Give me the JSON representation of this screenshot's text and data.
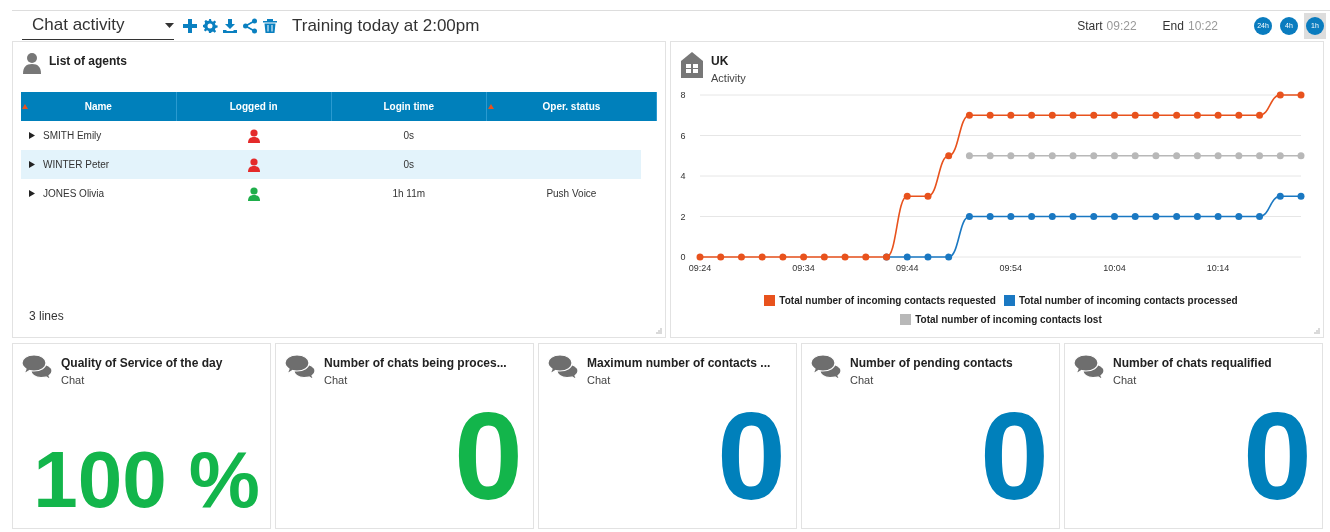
{
  "toolbar": {
    "dashboard": "Chat activity",
    "message": "Training today at 2:00pm",
    "start_label": "Start",
    "start_value": "09:22",
    "end_label": "End",
    "end_value": "10:22",
    "ranges": [
      {
        "label": "24h",
        "selected": false
      },
      {
        "label": "4h",
        "selected": false
      },
      {
        "label": "1h",
        "selected": true
      }
    ]
  },
  "agents": {
    "title": "List of agents",
    "columns": [
      {
        "label": "Name",
        "sorted": true
      },
      {
        "label": "Logged in",
        "sorted": false
      },
      {
        "label": "Login time",
        "sorted": false
      },
      {
        "label": "Oper. status",
        "sorted": true
      }
    ],
    "rows": [
      {
        "name": "SMITH Emily",
        "logged_in": false,
        "login_time": "0s",
        "selected": false
      },
      {
        "name": "WINTER Peter",
        "logged_in": false,
        "login_time": "0s",
        "selected": true
      },
      {
        "name": "JONES Olivia",
        "logged_in": true,
        "login_time": "1h 11m",
        "status": "Push Voice",
        "selected": false
      }
    ],
    "footer": "3 lines"
  },
  "activity": {
    "title": "UK",
    "subtitle": "Activity",
    "chart_data": {
      "type": "line",
      "categories": [
        "09:24",
        null,
        null,
        null,
        null,
        "09:34",
        null,
        null,
        null,
        null,
        "09:44",
        null,
        null,
        null,
        null,
        "09:54",
        null,
        null,
        null,
        null,
        "10:04",
        null,
        null,
        null,
        null,
        "10:14",
        null,
        null,
        null,
        null
      ],
      "ylim": [
        0,
        8
      ],
      "yticks": [
        0,
        2,
        4,
        6,
        8
      ],
      "grid": true,
      "legend": "bottom",
      "series": [
        {
          "name": "Total number of incoming contacts requested",
          "color": "#e8521d",
          "marker": "circle",
          "values": [
            0,
            0,
            0,
            0,
            0,
            0,
            0,
            0,
            0,
            0,
            3,
            3,
            5,
            7,
            7,
            7,
            7,
            7,
            7,
            7,
            7,
            7,
            7,
            7,
            7,
            7,
            7,
            7,
            8,
            8
          ]
        },
        {
          "name": "Total number of incoming contacts processed",
          "color": "#1a78c2",
          "marker": "circle",
          "values": [
            null,
            null,
            null,
            null,
            null,
            null,
            null,
            null,
            null,
            0,
            0,
            0,
            0,
            2,
            2,
            2,
            2,
            2,
            2,
            2,
            2,
            2,
            2,
            2,
            2,
            2,
            2,
            2,
            3,
            3
          ]
        },
        {
          "name": "Total number of incoming contacts lost",
          "color": "#b8b8b8",
          "marker": "circle",
          "values": [
            null,
            null,
            null,
            null,
            null,
            null,
            null,
            null,
            null,
            null,
            null,
            null,
            null,
            5,
            5,
            5,
            5,
            5,
            5,
            5,
            5,
            5,
            5,
            5,
            5,
            5,
            5,
            5,
            5,
            5
          ]
        }
      ]
    }
  },
  "kpis": [
    {
      "title": "Quality of Service of the day",
      "subtitle": "Chat",
      "value": "100 %",
      "color": "#13b54b"
    },
    {
      "title": "Number of chats being proces...",
      "subtitle": "Chat",
      "value": "0",
      "color": "#13b54b"
    },
    {
      "title": "Maximum number of contacts ...",
      "subtitle": "Chat",
      "value": "0",
      "color": "#0080bb"
    },
    {
      "title": "Number of pending contacts",
      "subtitle": "Chat",
      "value": "0",
      "color": "#0080bb"
    },
    {
      "title": "Number of chats requalified",
      "subtitle": "Chat",
      "value": "0",
      "color": "#0080bb"
    }
  ]
}
